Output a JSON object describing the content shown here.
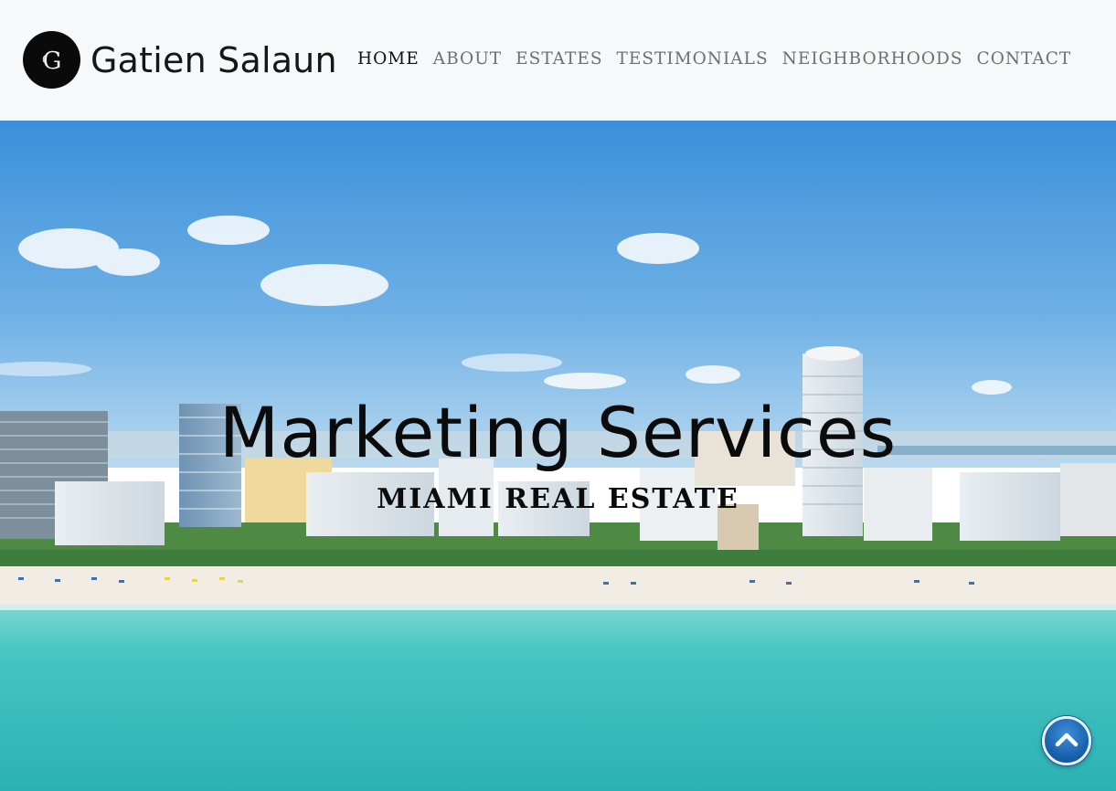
{
  "brand": {
    "name": "Gatien Salaun",
    "logo_letter": "G"
  },
  "nav": {
    "items": [
      {
        "label": "HOME",
        "active": true
      },
      {
        "label": "ABOUT",
        "active": false
      },
      {
        "label": "ESTATES",
        "active": false
      },
      {
        "label": "TESTIMONIALS",
        "active": false
      },
      {
        "label": "NEIGHBORHOODS",
        "active": false
      },
      {
        "label": "CONTACT",
        "active": false
      }
    ]
  },
  "hero": {
    "title": "Marketing Services",
    "subtitle": "MIAMI REAL ESTATE",
    "scene": "aerial-beach-skyline"
  },
  "colors": {
    "header_bg": "#f7f8fa",
    "nav_text": "#6f6f6f",
    "nav_active": "#111111",
    "sky": "#4a9be0",
    "ocean": "#3cc3c0",
    "sand": "#f1ece4",
    "scroll_button": "#1b63b0"
  },
  "icons": {
    "logo": "monogram-g-icon",
    "scroll_top": "chevron-up-icon"
  }
}
